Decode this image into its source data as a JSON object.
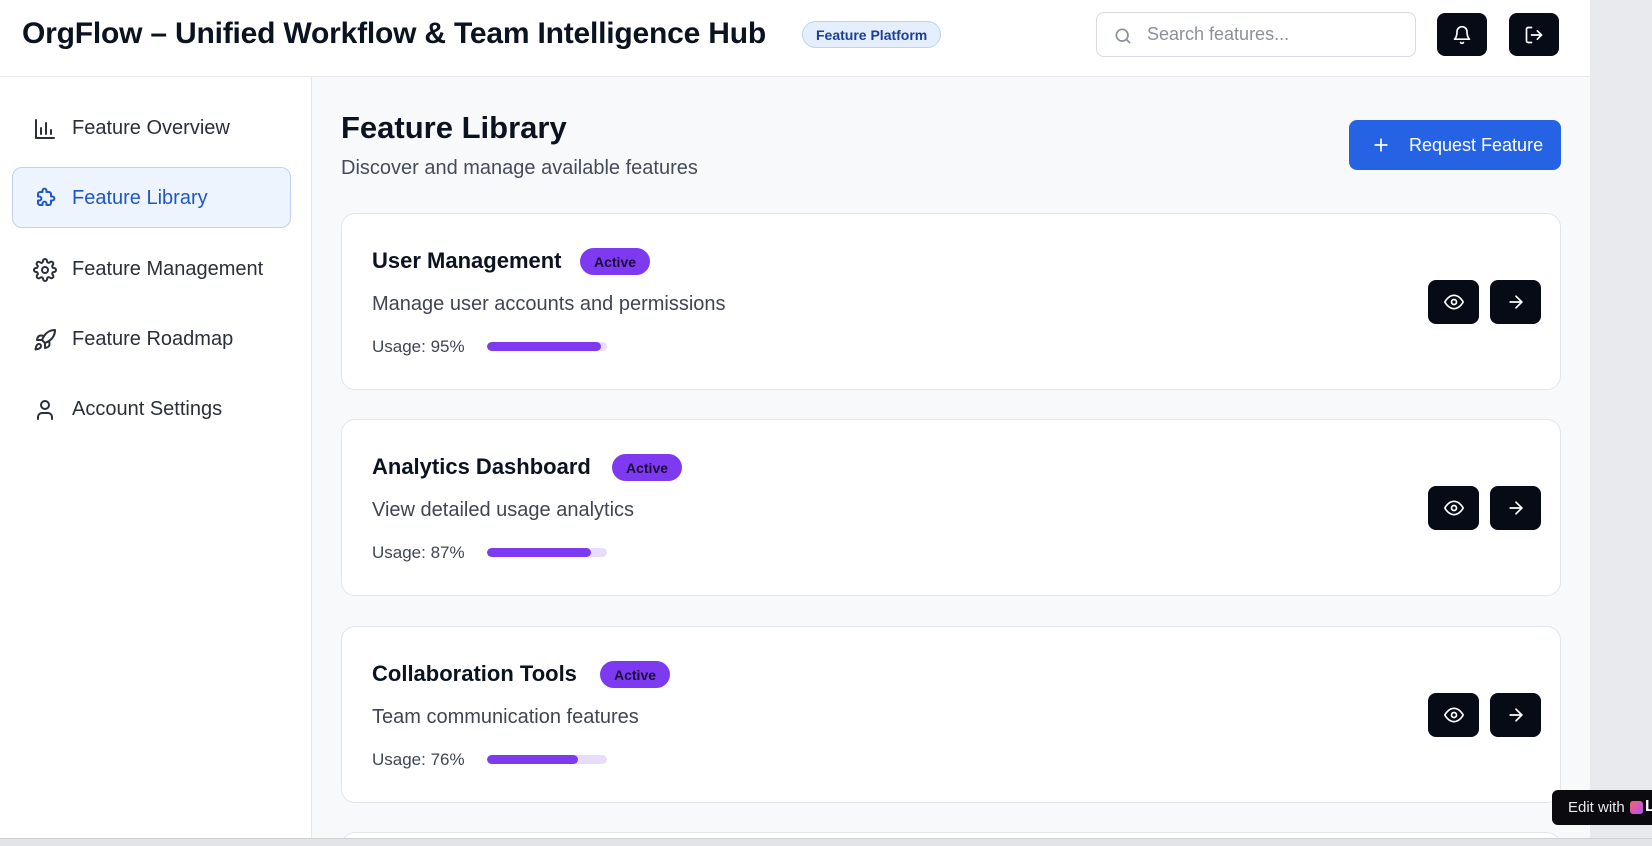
{
  "header": {
    "title": "OrgFlow – Unified Workflow & Team Intelligence Hub",
    "badge": "Feature Platform",
    "search_placeholder": "Search features..."
  },
  "sidebar": {
    "items": [
      {
        "label": "Feature Overview",
        "icon": "bar-chart-icon",
        "active": false
      },
      {
        "label": "Feature Library",
        "icon": "puzzle-icon",
        "active": true
      },
      {
        "label": "Feature Management",
        "icon": "gear-icon",
        "active": false
      },
      {
        "label": "Feature Roadmap",
        "icon": "rocket-icon",
        "active": false
      },
      {
        "label": "Account Settings",
        "icon": "user-icon",
        "active": false
      }
    ]
  },
  "main": {
    "title": "Feature Library",
    "subtitle": "Discover and manage available features",
    "request_button": "Request Feature",
    "features": [
      {
        "name": "User Management",
        "status": "Active",
        "description": "Manage user accounts and permissions",
        "usage_label": "Usage: 95%",
        "usage": 95
      },
      {
        "name": "Analytics Dashboard",
        "status": "Active",
        "description": "View detailed usage analytics",
        "usage_label": "Usage: 87%",
        "usage": 87
      },
      {
        "name": "Collaboration Tools",
        "status": "Active",
        "description": "Team communication features",
        "usage_label": "Usage: 76%",
        "usage": 76
      }
    ]
  },
  "edit_badge": {
    "text": "Edit with",
    "brand_fragment": "L"
  },
  "colors": {
    "accent": "#2563e4",
    "status_active": "#7e3af0",
    "dark_button": "#070b16"
  }
}
